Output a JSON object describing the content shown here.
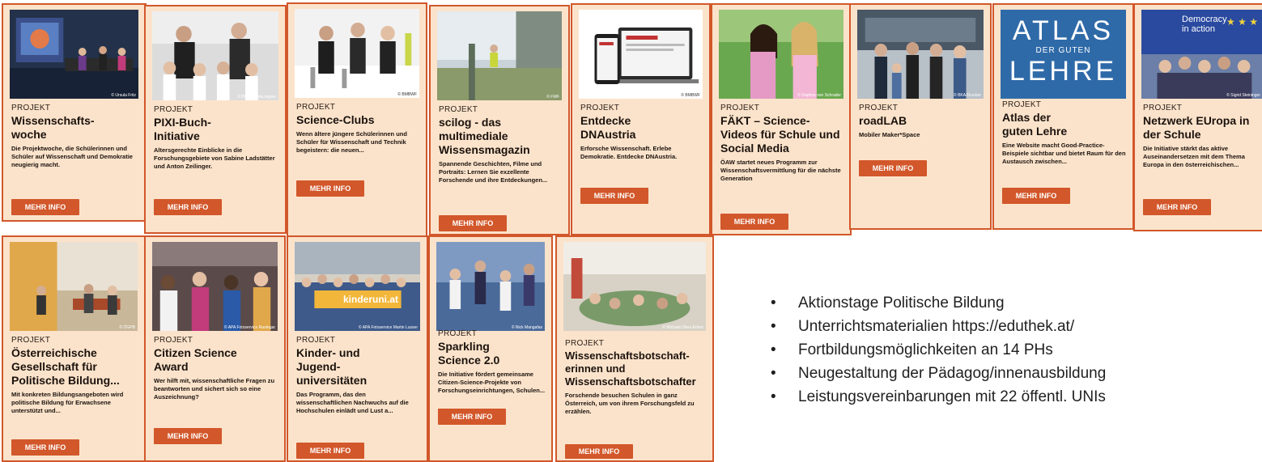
{
  "kicker": "PROJEKT",
  "button_label": "MEHR INFO",
  "cards": [
    {
      "title": "Wissenschafts-woche",
      "desc": "Die Projektwoche, die Schülerinnen und Schüler auf Wissenschaft und Demokratie neugierig macht.",
      "credit": "© Ursula Fritz"
    },
    {
      "title": "PIXI-Buch-Initiative",
      "desc": "Altersgerechte Einblicke in die Forschungsgebiete von Sabine Ladstätter und Anton Zeilinger.",
      "credit": "© BKA/Regina Aigner"
    },
    {
      "title": "Science-Clubs",
      "desc": "Wenn ältere jüngere Schülerinnen und Schüler für Wissenschaft und Technik begeistern: die neuen...",
      "credit": "© BMBWF"
    },
    {
      "title": "scilog - das multimediale Wissensmagazin",
      "desc": "Spannende Geschichten, Filme und Portraits: Lernen Sie exzellente Forschende und ihre Entdeckungen...",
      "credit": "© FWF"
    },
    {
      "title": "Entdecke DNAustria",
      "desc": "Erforsche Wissenschaft. Erlebe Demokratie. Entdecke DNAustria.",
      "credit": "© BMBWF"
    },
    {
      "title": "FÄKT – Science-Videos für Schule und Social Media",
      "desc": "ÖAW startet neues Programm zur Wissenschaftsvermittlung für die nächste Generation",
      "credit": "© Daphne von Schrader"
    },
    {
      "title": "roadLAB",
      "desc": "Mobiler Maker*Space",
      "credit": "© BKA/Drucker"
    },
    {
      "title": "Atlas der guten Lehre",
      "desc": "Eine Website macht Good-Practice-Beispiele sichtbar und bietet Raum für den Austausch zwischen...",
      "credit": "",
      "photo_text": [
        "ATLAS",
        "DER GUTEN",
        "LEHRE"
      ]
    },
    {
      "title": "Netzwerk EUropa in der Schule",
      "desc": "Die Initiative stärkt das aktive Auseinandersetzen mit dem Thema Europa in den österreichischen...",
      "credit": "© Sigrid Steininger",
      "photo_text": [
        "Democracy",
        "in action"
      ]
    },
    {
      "title": "Österreichische Gesellschaft für Politische Bildung...",
      "desc": "Mit konkreten Bildungsangeboten wird politische Bildung für Erwachsene unterstützt und...",
      "credit": "© ÖGPB"
    },
    {
      "title": "Citizen Science Award",
      "desc": "Wer hilft mit, wissenschaftliche Fragen zu beantworten und sichert sich so eine Auszeichnung?",
      "credit": "© APA Fotoservice Rastegar"
    },
    {
      "title": "Kinder- und Jugend-universitäten",
      "desc": "Das Programm, das den wissenschaftlichen Nachwuchs auf die Hochschulen einlädt und Lust a...",
      "credit": "© APA Fotoservice Martin Lusser",
      "photo_text": [
        "kinderuni.at"
      ]
    },
    {
      "title": "Sparkling Science 2.0",
      "desc": "Die Initiative fördert gemeinsame Citizen-Science-Projekte von Forschungseinrichtungen, Schulen...",
      "credit": "© Nick Mangafas"
    },
    {
      "title": "Wissenschaftsbotschaft-erinnen und Wissenschaftsbotschafter",
      "desc": "Forschende besuchen Schulen in ganz Österreich, um von ihrem Forschungsfeld zu erzählen.",
      "credit": "© Michael Obex-Erben"
    }
  ],
  "bullets": [
    "Aktionstage Politische Bildung",
    "Unterrichtsmaterialien https://eduthek.at/",
    "Fortbildungsmöglichkeiten an 14 PHs",
    "Neugestaltung der Pädagog/innenausbildung",
    "Leistungsvereinbarungen mit 22 öffentl. UNIs"
  ],
  "bullet_symbol": "•"
}
